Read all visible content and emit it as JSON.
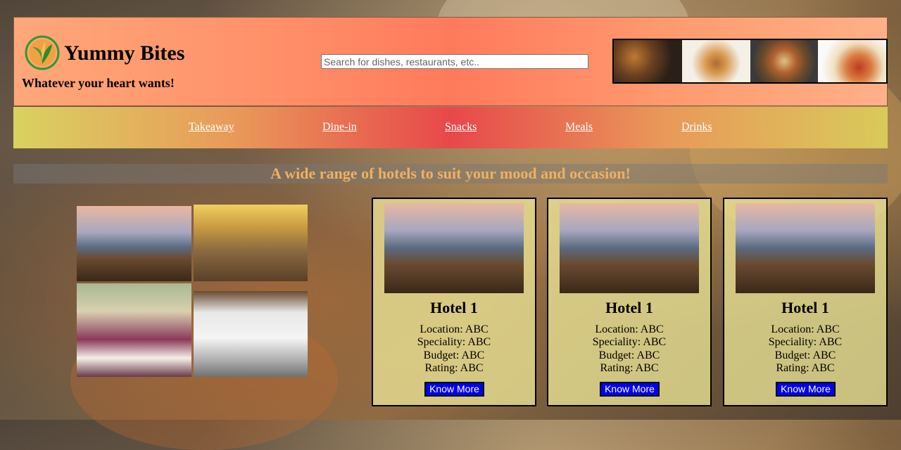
{
  "header": {
    "brand": "Yummy Bites",
    "tagline": "Whatever your heart wants!",
    "search_placeholder": "Search for dishes, restaurants, etc.."
  },
  "nav": {
    "items": [
      "Takeaway",
      "Dine-in",
      "Snacks",
      "Meals",
      "Drinks"
    ]
  },
  "hero": {
    "text": "A wide range of hotels to suit your mood and occasion!"
  },
  "cards": [
    {
      "title": "Hotel 1",
      "location": "Location: ABC",
      "speciality": "Speciality: ABC",
      "budget": "Budget: ABC",
      "rating": "Rating: ABC",
      "button": "Know More"
    },
    {
      "title": "Hotel 1",
      "location": "Location: ABC",
      "speciality": "Speciality: ABC",
      "budget": "Budget: ABC",
      "rating": "Rating: ABC",
      "button": "Know More"
    },
    {
      "title": "Hotel 1",
      "location": "Location: ABC",
      "speciality": "Speciality: ABC",
      "budget": "Budget: ABC",
      "rating": "Rating: ABC",
      "button": "Know More"
    }
  ],
  "colors": {
    "header_gradient": [
      "#ffa77a",
      "#ff7a5c",
      "#ffb089"
    ],
    "nav_gradient": [
      "#d8d260",
      "#e8484a",
      "#d8ca5a"
    ],
    "hero_text": "#f0b060",
    "button": "#0000ee"
  },
  "icons": {
    "logo": "leaf-logo-icon"
  }
}
